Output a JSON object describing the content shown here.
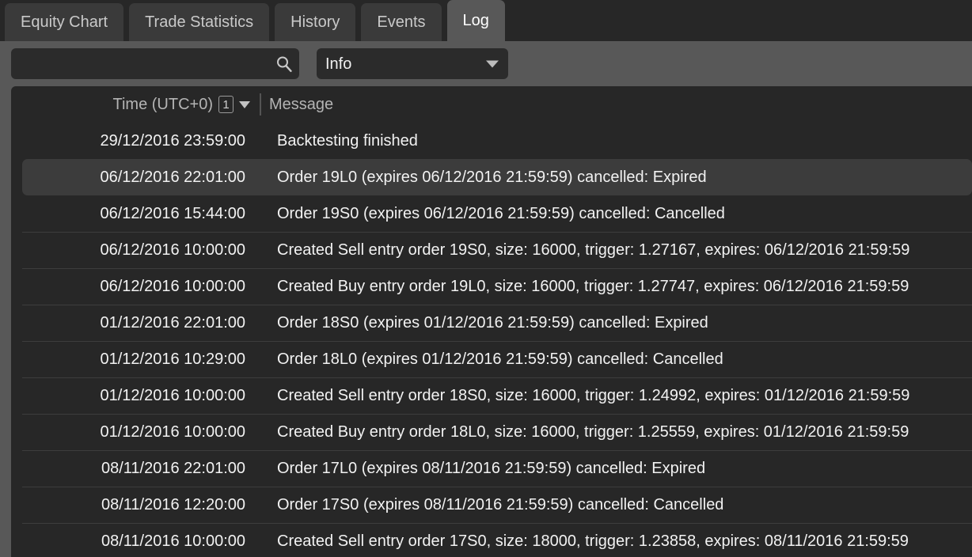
{
  "tabs": [
    {
      "label": "Equity Chart",
      "active": false
    },
    {
      "label": "Trade Statistics",
      "active": false
    },
    {
      "label": "History",
      "active": false
    },
    {
      "label": "Events",
      "active": false
    },
    {
      "label": "Log",
      "active": true
    }
  ],
  "toolbar": {
    "search": {
      "value": "",
      "placeholder": "",
      "icon": "search-icon"
    },
    "level_filter": {
      "selected": "Info",
      "icon": "chevron-down-icon"
    }
  },
  "table": {
    "columns": {
      "time": {
        "label": "Time (UTC+0)",
        "sort_order": "1",
        "sort_direction": "descending"
      },
      "message": {
        "label": "Message"
      }
    },
    "rows": [
      {
        "time": "29/12/2016 23:59:00",
        "message": "Backtesting finished",
        "selected": false,
        "first": true
      },
      {
        "time": "06/12/2016 22:01:00",
        "message": "Order 19L0 (expires 06/12/2016 21:59:59) cancelled: Expired",
        "selected": true,
        "first": false
      },
      {
        "time": "06/12/2016 15:44:00",
        "message": "Order 19S0 (expires 06/12/2016 21:59:59) cancelled: Cancelled",
        "selected": false,
        "first": true
      },
      {
        "time": "06/12/2016 10:00:00",
        "message": "Created Sell entry order 19S0, size: 16000, trigger: 1.27167, expires: 06/12/2016 21:59:59",
        "selected": false,
        "first": false
      },
      {
        "time": "06/12/2016 10:00:00",
        "message": "Created Buy entry order 19L0, size: 16000, trigger: 1.27747, expires: 06/12/2016 21:59:59",
        "selected": false,
        "first": false
      },
      {
        "time": "01/12/2016 22:01:00",
        "message": "Order 18S0 (expires 01/12/2016 21:59:59) cancelled: Expired",
        "selected": false,
        "first": false
      },
      {
        "time": "01/12/2016 10:29:00",
        "message": "Order 18L0 (expires 01/12/2016 21:59:59) cancelled: Cancelled",
        "selected": false,
        "first": false
      },
      {
        "time": "01/12/2016 10:00:00",
        "message": "Created Sell entry order 18S0, size: 16000, trigger: 1.24992, expires: 01/12/2016 21:59:59",
        "selected": false,
        "first": false
      },
      {
        "time": "01/12/2016 10:00:00",
        "message": "Created Buy entry order 18L0, size: 16000, trigger: 1.25559, expires: 01/12/2016 21:59:59",
        "selected": false,
        "first": false
      },
      {
        "time": "08/11/2016 22:01:00",
        "message": "Order 17L0 (expires 08/11/2016 21:59:59) cancelled: Expired",
        "selected": false,
        "first": false
      },
      {
        "time": "08/11/2016 12:20:00",
        "message": "Order 17S0 (expires 08/11/2016 21:59:59) cancelled: Cancelled",
        "selected": false,
        "first": false
      },
      {
        "time": "08/11/2016 10:00:00",
        "message": "Created Sell entry order 17S0, size: 18000, trigger: 1.23858, expires: 08/11/2016 21:59:59",
        "selected": false,
        "first": false
      }
    ]
  },
  "colors": {
    "window_bg": "#272727",
    "chrome_bg": "#585858",
    "tab_inactive": "#3a3a3a",
    "tab_active": "#585858",
    "field_bg": "#2b2b2b",
    "row_selected": "#3c3c3c",
    "row_separator": "#3d3d3d",
    "text_primary": "#f2f2f2",
    "text_muted": "#b4b4b4"
  }
}
